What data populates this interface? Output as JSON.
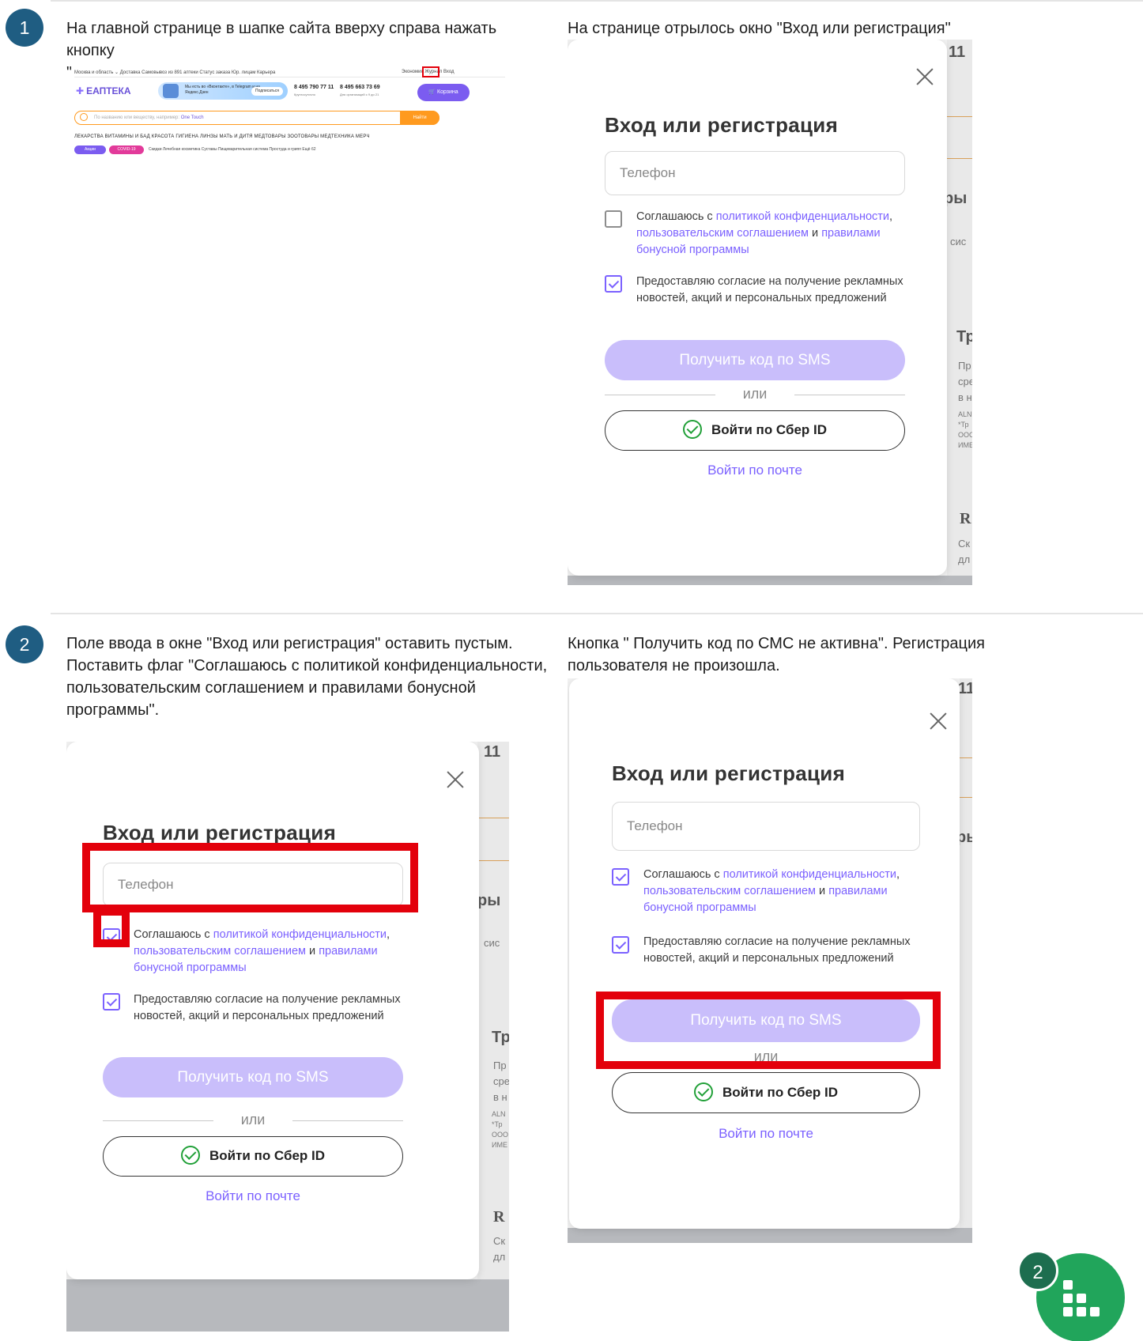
{
  "step1": {
    "number": "1",
    "caption_left": "На главной странице  в шапке сайта вверху справа нажать кнопку\n\"Вход\"",
    "caption_right": "На странице отрылось окно \"Вход или регистрация\""
  },
  "step2": {
    "number": "2",
    "caption_left": "Поле ввода в окне \"Вход или регистрация\" оставить пустым.\nПоставить флаг \"Соглашаюсь с политикой конфиденциальности,\nпользовательским соглашением и правилами бонусной\nпрограммы\".",
    "caption_right": "Кнопка \" Получить код по СМС не активна\". Регистрация\nпользователя не произошла."
  },
  "mini_header": {
    "top_links": "Москва и область ⌄   Доставка   Самовывоз из 891 аптеки   Статус заказа   Юр. лицам   Карьера",
    "top_right": "Экономия   Журнал   Вход",
    "logo": "ЕАПТЕКА",
    "promo_text": "Мы есть во «Вконтакте», в Telegram и на Яндекс.Дзен",
    "promo_button": "Подписаться",
    "phone1": "8 495 790 77 11",
    "phone1_sub": "Круглосуточно",
    "phone2": "8 495 663 73 69",
    "phone2_sub": "Для организаций с 9 до 21",
    "cart": "Корзина",
    "search_placeholder": "По названию или веществу, например: ",
    "search_hint": "One Touch",
    "search_button": "Найти",
    "categories": "ЛЕКАРСТВА   ВИТАМИНЫ И БАД   КРАСОТА   ГИГИЕНА   ЛИНЗЫ   МАТЬ И ДИТЯ   МЕДТОВАРЫ   ЗООТОВАРЫ   МЕДТЕХНИКА   МЕРЧ",
    "pill_sales": "Акции",
    "pill_covid": "COVID-19",
    "tags": "Скидки     Лечебная косметика     Суставы     Пищеварительная система     Простуда и грипп     Ещё 62"
  },
  "modal": {
    "title": "Вход или регистрация",
    "phone_placeholder": "Телефон",
    "agree_prefix": "Соглашаюсь с ",
    "agree_link1": "политикой конфиденциальности",
    "agree_comma": ",",
    "agree_link2": "пользовательским соглашением",
    "agree_and": " и ",
    "agree_link3": "правилами бонусной программы",
    "ads_consent": "Предоставляю согласие на получение рекламных новостей, акций и персональных предложений",
    "sms_button": "Получить код по SMS",
    "or": "или",
    "sber_button": "Войти по Сбер ID",
    "mail_link": "Войти по почте"
  },
  "bg_fragments": {
    "num11": "11",
    "ry": "ры",
    "sis": "сис",
    "tr": "Тр",
    "body_small": "Пр\nсре\nв н",
    "tiny": "ALN\n*Тр\nООО\nИМЕ",
    "r": "R",
    "sk": "Ск\nдл"
  },
  "fab": {
    "badge": "2",
    "icon": "grid-icon"
  }
}
